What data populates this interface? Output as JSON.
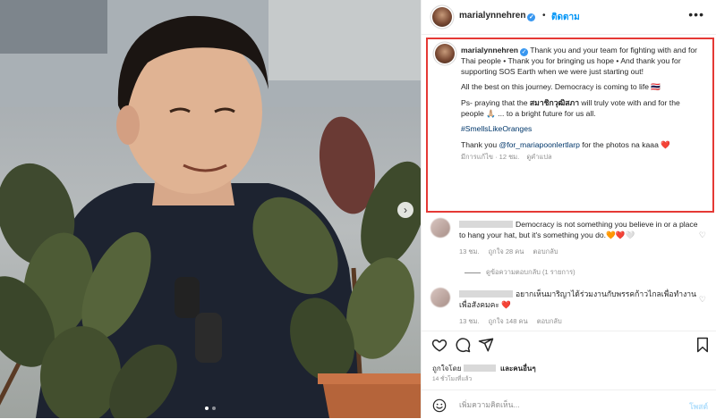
{
  "post": {
    "username": "marialynnehren",
    "verified_icon": "verified-badge-icon",
    "separator": "•",
    "follow_label": "ติดตาม",
    "more_label": "•••"
  },
  "caption": {
    "username": "marialynnehren",
    "p1": "Thank you and your team for fighting with and for Thai people • Thank you for bringing us hope • And thank you for supporting SOS Earth when we were just starting out!",
    "p2": "All the best on this journey. Democracy is coming to life 🇹🇭",
    "p3_pre": "Ps- praying that the ",
    "p3_bold": "สมาชิกวุฒิสภา",
    "p3_post": " will truly vote with and for the people 🙏🏼 ... to a bright future for us all.",
    "hashtag": "#SmellsLikeOranges",
    "p5_pre": "Thank you ",
    "p5_mention": "@for_mariapoonlertlarp",
    "p5_post": " for the photos na kaaa ❤️",
    "meta_edited": "มีการแก้ไข · 12 ชม.",
    "meta_translate": "ดูคำแปล"
  },
  "comments": [
    {
      "text": "Democracy is not something you believe in or a place to hang your hat, but it's something you do.🧡❤️🤍",
      "time": "13 ชม.",
      "likes": "ถูกใจ 28 คน",
      "reply": "ตอบกลับ",
      "view_replies": "ดูข้อความตอบกลับ (1 รายการ)"
    },
    {
      "text": "อยากเห็นมาริญาได้ร่วมงานกับพรรคก้าวไกลเพื่อทำงานเพื่อสังคมคะ ❤️",
      "time": "13 ชม.",
      "likes": "ถูกใจ 148 คน",
      "reply": "ตอบกลับ"
    }
  ],
  "actions": {
    "like_icon": "heart-icon",
    "comment_icon": "comment-icon",
    "share_icon": "share-icon",
    "save_icon": "bookmark-icon"
  },
  "likes": {
    "prefix": "ถูกใจโดย",
    "suffix": "และคนอื่นๆ"
  },
  "timestamp": "14 ชั่วโมงที่แล้ว",
  "add_comment": {
    "placeholder": "เพิ่มความคิดเห็น...",
    "post_label": "โพสต์"
  },
  "carousel": {
    "next_icon": "›",
    "slide_count": 2,
    "active_slide": 1
  },
  "colors": {
    "accent": "#0095f6",
    "highlight_border": "#e53935",
    "muted": "#8e8e8e"
  }
}
